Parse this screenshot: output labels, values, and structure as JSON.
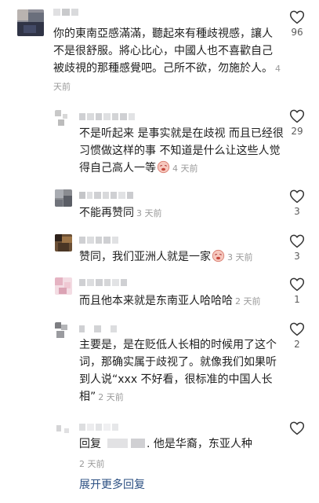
{
  "comments": [
    {
      "text": "你的東南亞感滿滿，聽起來有種歧視感，讓人不是很舒服。將心比心，中國人也不喜歡自己被歧視的那種感覺吧。己所不欲，勿施於人。",
      "time": "4 天前",
      "likes": "96"
    },
    {
      "text": "不是听起来 是事实就是在歧视 而且已经很习惯做这样的事 不知道是什么让这些人觉得自己高人一等",
      "time": "4 天前",
      "likes": "29"
    },
    {
      "text": "不能再赞同",
      "time": "3 天前",
      "likes": "3"
    },
    {
      "text": "赞同，我们亚洲人就是一家",
      "time": "3 天前",
      "likes": "3"
    },
    {
      "text": "而且他本来就是东南亚人哈哈哈",
      "time": "2 天前",
      "likes": "1"
    },
    {
      "text": "主要是，是在贬低人长相的时候用了这个词，那确实属于歧视了。就像我们如果听到人说“xxx 不好看，很标准的中国人长相”",
      "time": "2 天前",
      "likes": "2"
    },
    {
      "prefix": "回复",
      "text": ". 他是华裔，东亚人种",
      "time": "2 天前",
      "likes": ""
    }
  ],
  "more_replies": "展开更多回复",
  "colors": {
    "accent": "#2b4f82",
    "muted": "#9a9a9a"
  },
  "icons": {
    "like": "heart-outline-icon",
    "emoji": "face-emoji-icon"
  }
}
